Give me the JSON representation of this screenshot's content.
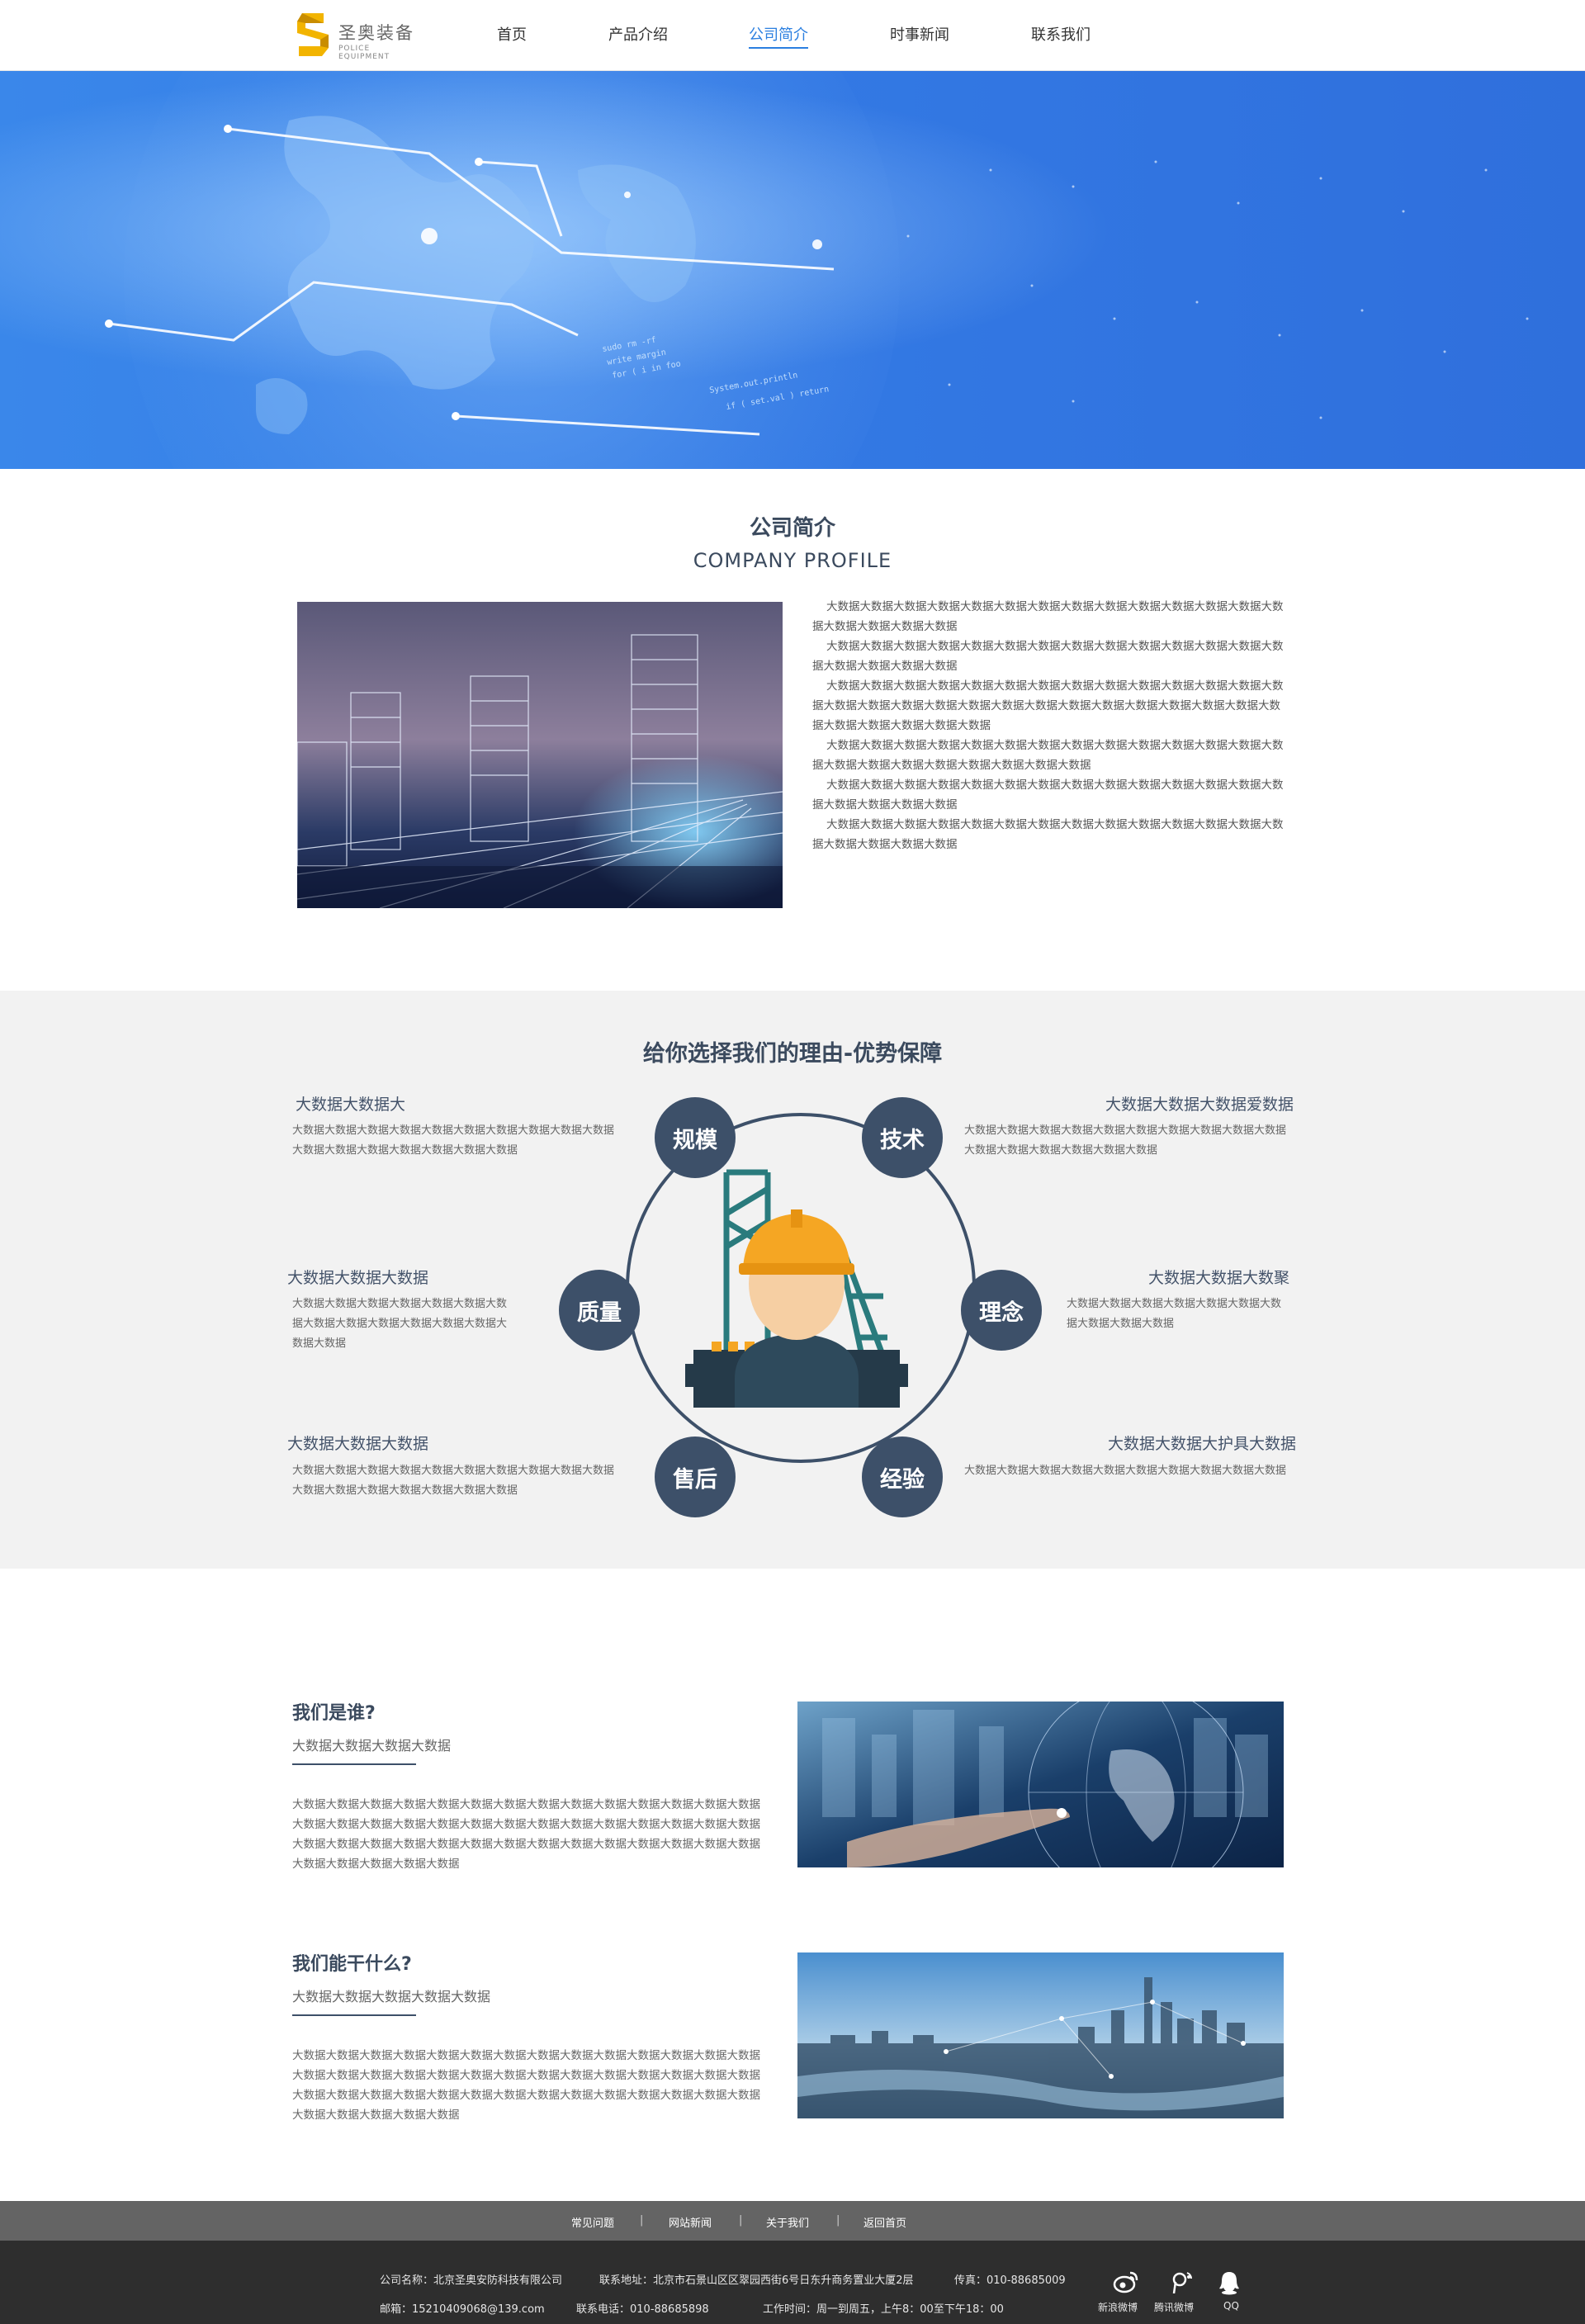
{
  "header": {
    "logo_name": "圣奥装备",
    "logo_sub": "POLICE EQUIPMENT",
    "nav": [
      "首页",
      "产品介绍",
      "公司简介",
      "时事新闻",
      "联系我们"
    ],
    "active_index": 2
  },
  "profile": {
    "title": "公司简介",
    "subtitle": "COMPANY PROFILE",
    "paragraphs": [
      "大数据大数据大数据大数据大数据大数据大数据大数据大数据大数据大数据大数据大数据大数据大数据大数据大数据大数据",
      "大数据大数据大数据大数据大数据大数据大数据大数据大数据大数据大数据大数据大数据大数据大数据大数据大数据大数据",
      "大数据大数据大数据大数据大数据大数据大数据大数据大数据大数据大数据大数据大数据大数据大数据大数据大数据大数据大数据大数据大数据大数据大数据大数据大数据大数据大数据大数据大数据大数据大数据大数据大数据",
      "大数据大数据大数据大数据大数据大数据大数据大数据大数据大数据大数据大数据大数据大数据大数据大数据大数据大数据大数据大数据大数据大数据",
      "大数据大数据大数据大数据大数据大数据大数据大数据大数据大数据大数据大数据大数据大数据大数据大数据大数据大数据",
      "大数据大数据大数据大数据大数据大数据大数据大数据大数据大数据大数据大数据大数据大数据大数据大数据大数据大数据"
    ]
  },
  "advantages": {
    "title": "给你选择我们的理由-优势保障",
    "circles": [
      "规模",
      "技术",
      "质量",
      "理念",
      "售后",
      "经验"
    ],
    "items": [
      {
        "title": "大数据大数据大",
        "text": "大数据大数据大数据大数据大数据大数据大数据大数据大数据大数据大数据大数据大数据大数据大数据大数据大数据"
      },
      {
        "title": "大数据大数据大数据爱数据",
        "text": "大数据大数据大数据大数据大数据大数据大数据大数据大数据大数据大数据大数据大数据大数据大数据大数据"
      },
      {
        "title": "大数据大数据大数据",
        "text": "大数据大数据大数据大数据大数据大数据大数据大数据大数据大数据大数据大数据大数据大数据大数据"
      },
      {
        "title": "大数据大数据大数聚",
        "text": "大数据大数据大数据大数据大数据大数据大数据大数据大数据大数据"
      },
      {
        "title": "大数据大数据大数据",
        "text": "大数据大数据大数据大数据大数据大数据大数据大数据大数据大数据大数据大数据大数据大数据大数据大数据大数据"
      },
      {
        "title": "大数据大数据大护具大数据",
        "text": "大数据大数据大数据大数据大数据大数据大数据大数据大数据大数据"
      }
    ]
  },
  "who": {
    "title": "我们是谁?",
    "subtitle": "大数据大数据大数据大数据",
    "text": "大数据大数据大数据大数据大数据大数据大数据大数据大数据大数据大数据大数据大数据大数据大数据大数据大数据大数据大数据大数据大数据大数据大数据大数据大数据大数据大数据大数据大数据大数据大数据大数据大数据大数据大数据大数据大数据大数据大数据大数据大数据大数据大数据大数据大数据大数据大数据"
  },
  "what": {
    "title": "我们能干什么?",
    "subtitle": "大数据大数据大数据大数据大数据",
    "text": "大数据大数据大数据大数据大数据大数据大数据大数据大数据大数据大数据大数据大数据大数据大数据大数据大数据大数据大数据大数据大数据大数据大数据大数据大数据大数据大数据大数据大数据大数据大数据大数据大数据大数据大数据大数据大数据大数据大数据大数据大数据大数据大数据大数据大数据大数据大数据"
  },
  "footer": {
    "links": [
      "常见问题",
      "网站新闻",
      "关于我们",
      "返回首页"
    ],
    "company": "公司名称：北京圣奥安防科技有限公司",
    "address": "联系地址：北京市石景山区区翠园西街6号日东升商务置业大厦2层",
    "fax": "传真：010-88685009",
    "email": "邮箱：15210409068@139.com",
    "phone": "联系电话：010-88685898",
    "hours": "工作时间：周一到周五，上午8：00至下午18：00",
    "social": [
      "新浪微博",
      "腾讯微博",
      "QQ"
    ]
  }
}
